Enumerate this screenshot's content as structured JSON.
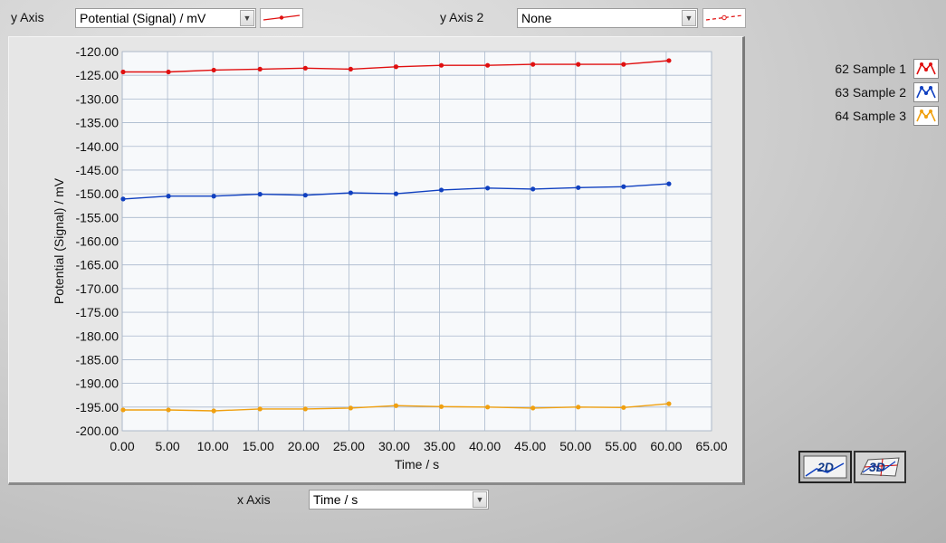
{
  "top_bar": {
    "y_axis_label": "y Axis",
    "y_axis_value": "Potential (Signal) / mV",
    "y_axis2_label": "y Axis 2",
    "y_axis2_value": "None"
  },
  "bottom_bar": {
    "x_axis_label": "x Axis",
    "x_axis_value": "Time / s"
  },
  "legend": [
    {
      "label": "62 Sample 1",
      "color": "#e01010"
    },
    {
      "label": "63 Sample 2",
      "color": "#1040c0"
    },
    {
      "label": "64 Sample 3",
      "color": "#f0a010"
    }
  ],
  "view_buttons": {
    "two_d": "2D",
    "three_d": "3D"
  },
  "chart_data": {
    "type": "line",
    "xlabel": "Time / s",
    "ylabel": "Potential (Signal) / mV",
    "xlim": [
      0,
      65
    ],
    "ylim": [
      -200,
      -120
    ],
    "x_ticks": [
      "0.00",
      "5.00",
      "10.00",
      "15.00",
      "20.00",
      "25.00",
      "30.00",
      "35.00",
      "40.00",
      "45.00",
      "50.00",
      "55.00",
      "60.00",
      "65.00"
    ],
    "y_ticks": [
      "-120.00",
      "-125.00",
      "-130.00",
      "-135.00",
      "-140.00",
      "-145.00",
      "-150.00",
      "-155.00",
      "-160.00",
      "-165.00",
      "-170.00",
      "-175.00",
      "-180.00",
      "-185.00",
      "-190.00",
      "-195.00",
      "-200.00"
    ],
    "grid": true,
    "series": [
      {
        "name": "62 Sample 1",
        "color": "#e01010",
        "x": [
          0.1,
          5.1,
          10.1,
          15.2,
          20.2,
          25.2,
          30.2,
          35.2,
          40.3,
          45.3,
          50.3,
          55.3,
          60.3
        ],
        "y": [
          -124.3,
          -124.3,
          -123.9,
          -123.7,
          -123.5,
          -123.7,
          -123.2,
          -122.9,
          -122.9,
          -122.7,
          -122.7,
          -122.7,
          -121.9
        ]
      },
      {
        "name": "63 Sample 2",
        "color": "#1040c0",
        "x": [
          0.1,
          5.1,
          10.1,
          15.2,
          20.2,
          25.2,
          30.2,
          35.2,
          40.3,
          45.3,
          50.3,
          55.3,
          60.3
        ],
        "y": [
          -151.1,
          -150.5,
          -150.5,
          -150.1,
          -150.3,
          -149.8,
          -150.0,
          -149.2,
          -148.8,
          -149.0,
          -148.7,
          -148.5,
          -147.9
        ]
      },
      {
        "name": "64 Sample 3",
        "color": "#f0a010",
        "x": [
          0.1,
          5.1,
          10.1,
          15.2,
          20.2,
          25.2,
          30.2,
          35.2,
          40.3,
          45.3,
          50.3,
          55.3,
          60.3
        ],
        "y": [
          -195.6,
          -195.6,
          -195.8,
          -195.4,
          -195.4,
          -195.2,
          -194.7,
          -194.9,
          -195.0,
          -195.2,
          -195.0,
          -195.1,
          -194.3
        ]
      }
    ]
  }
}
